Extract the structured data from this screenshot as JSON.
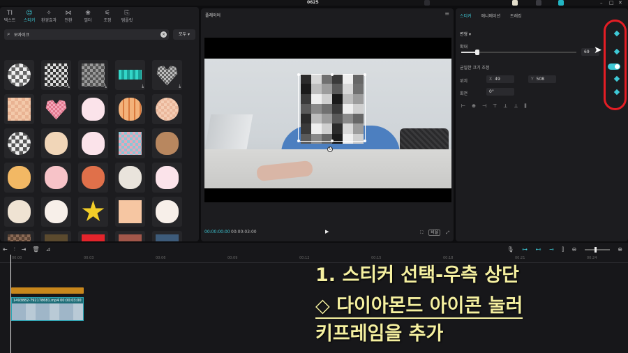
{
  "titlebar": {
    "app_title": "",
    "project_name": "0625",
    "export_small": "",
    "user": "",
    "pro_label": "",
    "share_label": "",
    "export_label": ""
  },
  "left_panel": {
    "tabs": [
      {
        "icon": "TI",
        "label": "텍스트",
        "active": false
      },
      {
        "icon": "☺",
        "label": "스티커",
        "active": true
      },
      {
        "icon": "✧",
        "label": "환경효과",
        "active": false
      },
      {
        "icon": "⋈",
        "label": "전환",
        "active": false
      },
      {
        "icon": "❀",
        "label": "필터",
        "active": false
      },
      {
        "icon": "⚟",
        "label": "조정",
        "active": false
      },
      {
        "icon": "⎘",
        "label": "템플릿",
        "active": false
      }
    ],
    "search_value": "모자이크",
    "copyright_label": "모두"
  },
  "player": {
    "header": "플레이어",
    "time_current": "00:00:00:00",
    "time_total": "00:00:03:00",
    "ratio_label": "비율"
  },
  "properties": {
    "tabs": [
      {
        "label": "스티커",
        "active": true
      },
      {
        "label": "애니메이션",
        "active": false
      },
      {
        "label": "트래킹",
        "active": false
      }
    ],
    "section_basic": "변형",
    "scale_label": "확대",
    "scale_value": "69",
    "uniform_label": "균일한 크기 조정",
    "position_label": "위치",
    "pos_x_label": "X",
    "pos_x_value": "49",
    "pos_y_label": "Y",
    "pos_y_value": "508",
    "rotation_label": "회전",
    "rotation_value": "0°",
    "accent_color": "#3ec9d6",
    "highlight_color": "#e41d24"
  },
  "timeline": {
    "ruler_marks": [
      "00:00",
      "00:03",
      "00:06",
      "00:09",
      "00:12",
      "00:15",
      "00:18",
      "00:21",
      "00:24"
    ],
    "clip_label": "1493882-792178681.mp4   00:00:03:00"
  },
  "overlay": {
    "line1": "1. 스티커 선택-우측 상단",
    "line2": "◇ 다이아몬드 아이콘 눌러",
    "line3": "키프레임을 추가"
  }
}
